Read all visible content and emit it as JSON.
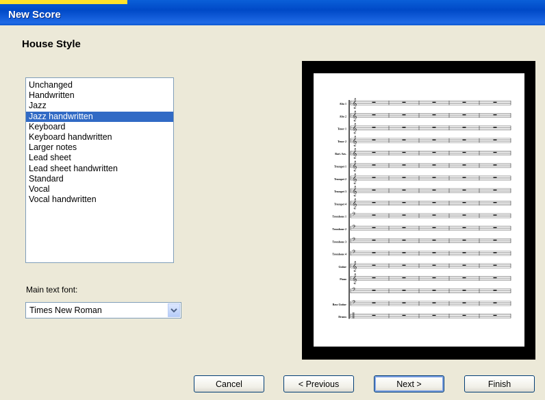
{
  "window": {
    "title": "New Score"
  },
  "page": {
    "heading": "House Style"
  },
  "styles": {
    "items": [
      "Unchanged",
      "Handwritten",
      "Jazz",
      "Jazz handwritten",
      "Keyboard",
      "Keyboard handwritten",
      "Larger notes",
      "Lead sheet",
      "Lead sheet handwritten",
      "Standard",
      "Vocal",
      "Vocal handwritten"
    ],
    "selected": "Jazz handwritten"
  },
  "font": {
    "label": "Main text font:",
    "value": "Times New Roman"
  },
  "preview": {
    "instruments": [
      {
        "name": "Alto 1",
        "clef": "treble"
      },
      {
        "name": "Alto 2",
        "clef": "treble"
      },
      {
        "name": "Tenor 1",
        "clef": "treble"
      },
      {
        "name": "Tenor 2",
        "clef": "treble"
      },
      {
        "name": "Bari. Sax.",
        "clef": "treble"
      },
      {
        "name": "Trumpet 1",
        "clef": "treble"
      },
      {
        "name": "Trumpet 2",
        "clef": "treble"
      },
      {
        "name": "Trumpet 3",
        "clef": "treble"
      },
      {
        "name": "Trumpet 4",
        "clef": "treble"
      },
      {
        "name": "Trombone 1",
        "clef": "bass"
      },
      {
        "name": "Trombone 2",
        "clef": "bass"
      },
      {
        "name": "Trombone 3",
        "clef": "bass"
      },
      {
        "name": "Trombone 4",
        "clef": "bass"
      },
      {
        "name": "Guitar",
        "clef": "treble"
      },
      {
        "name": "Piano",
        "clef": "treble"
      },
      {
        "name": "",
        "clef": "bass"
      },
      {
        "name": "Bass Guitar",
        "clef": "bass"
      },
      {
        "name": "Drums",
        "clef": "percussion"
      }
    ]
  },
  "buttons": {
    "cancel": "Cancel",
    "previous": "< Previous",
    "next": "Next >",
    "finish": "Finish"
  },
  "colors": {
    "selection": "#316ac5",
    "titlebar": "#0a5fd8",
    "dialog": "#ece9d8"
  }
}
